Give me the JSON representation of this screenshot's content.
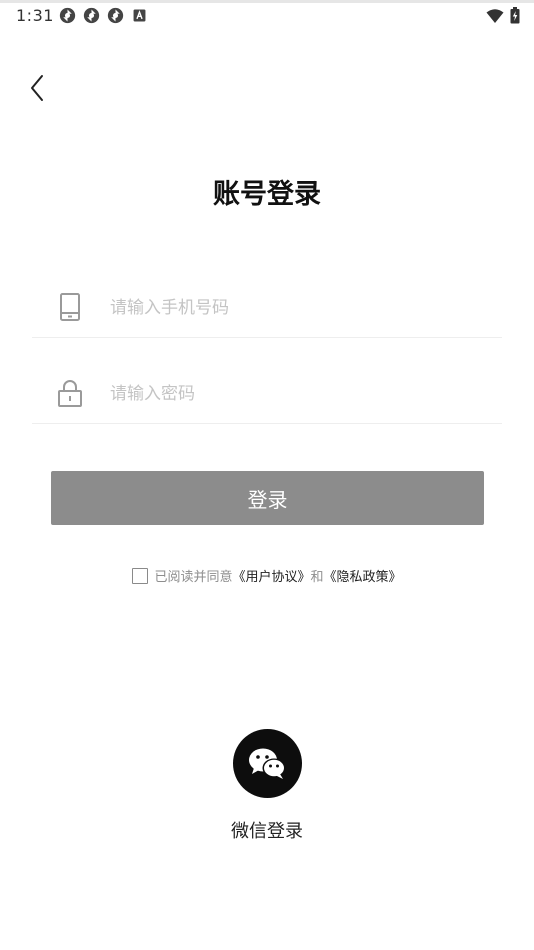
{
  "status_bar": {
    "time": "1:31",
    "left_icons": [
      "sync-icon",
      "sync-icon",
      "sync-icon",
      "keyboard-a-icon"
    ],
    "right_icons": [
      "wifi-icon",
      "battery-charging-icon"
    ]
  },
  "header": {
    "title": "账号登录"
  },
  "form": {
    "phone_placeholder": "请输入手机号码",
    "password_placeholder": "请输入密码",
    "login_label": "登录"
  },
  "agreement": {
    "prefix": "已阅读并同意",
    "user_agreement": "《用户协议》",
    "conjunction": "和",
    "privacy_policy": "《隐私政策》"
  },
  "wechat": {
    "label": "微信登录"
  },
  "colors": {
    "button_gray": "#8c8c8c",
    "placeholder": "#c4c4c4",
    "wechat_circle": "#0d0d0d"
  }
}
